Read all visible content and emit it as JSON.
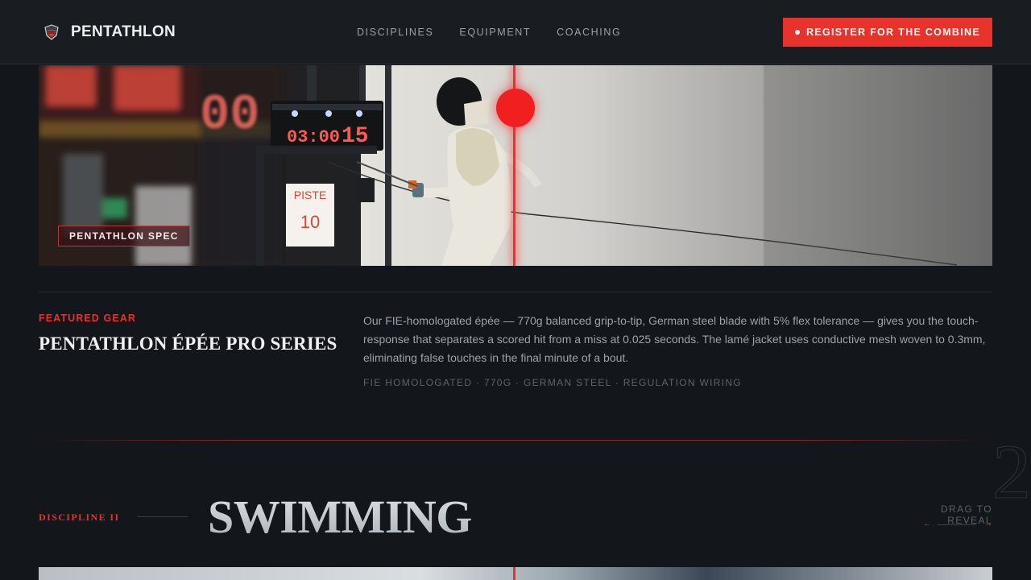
{
  "header": {
    "brand": "PENTATHLON",
    "nav": [
      "DISCIPLINES",
      "EQUIPMENT",
      "COACHING"
    ],
    "cta_label": "REGISTER FOR THE COMBINE"
  },
  "hero": {
    "badge": "PENTATHLON SPEC",
    "scoreboard": {
      "time": "03:00",
      "score": "15",
      "big_digits": "00"
    },
    "piste_sign": {
      "word": "PISTE",
      "number": "10"
    }
  },
  "featured": {
    "kicker": "FEATURED GEAR",
    "title": "PENTATHLON ÉPÉE PRO SERIES",
    "body": "Our FIE-homologated épée — 770g balanced grip-to-tip, German steel blade with 5% flex tolerance — gives you the touch-response that separates a scored hit from a miss at 0.025 seconds. The lamé jacket uses conductive mesh woven to 0.3mm, eliminating false touches in the final minute of a bout.",
    "specs": "FIE HOMOLOGATED · 770G · GERMAN STEEL · REGULATION WIRING"
  },
  "discipline": {
    "kicker": "DISCIPLINE II",
    "title": "SWIMMING",
    "numeral": "2",
    "drag_label": "DRAG TO REVEAL",
    "left_arrow": "←",
    "right_arrow": "→"
  },
  "colors": {
    "accent": "#e8322c",
    "background": "#13161a",
    "header": "#1a1d21"
  },
  "icons": {
    "brand": "fencer-mask-icon",
    "cta": "dot-icon"
  }
}
